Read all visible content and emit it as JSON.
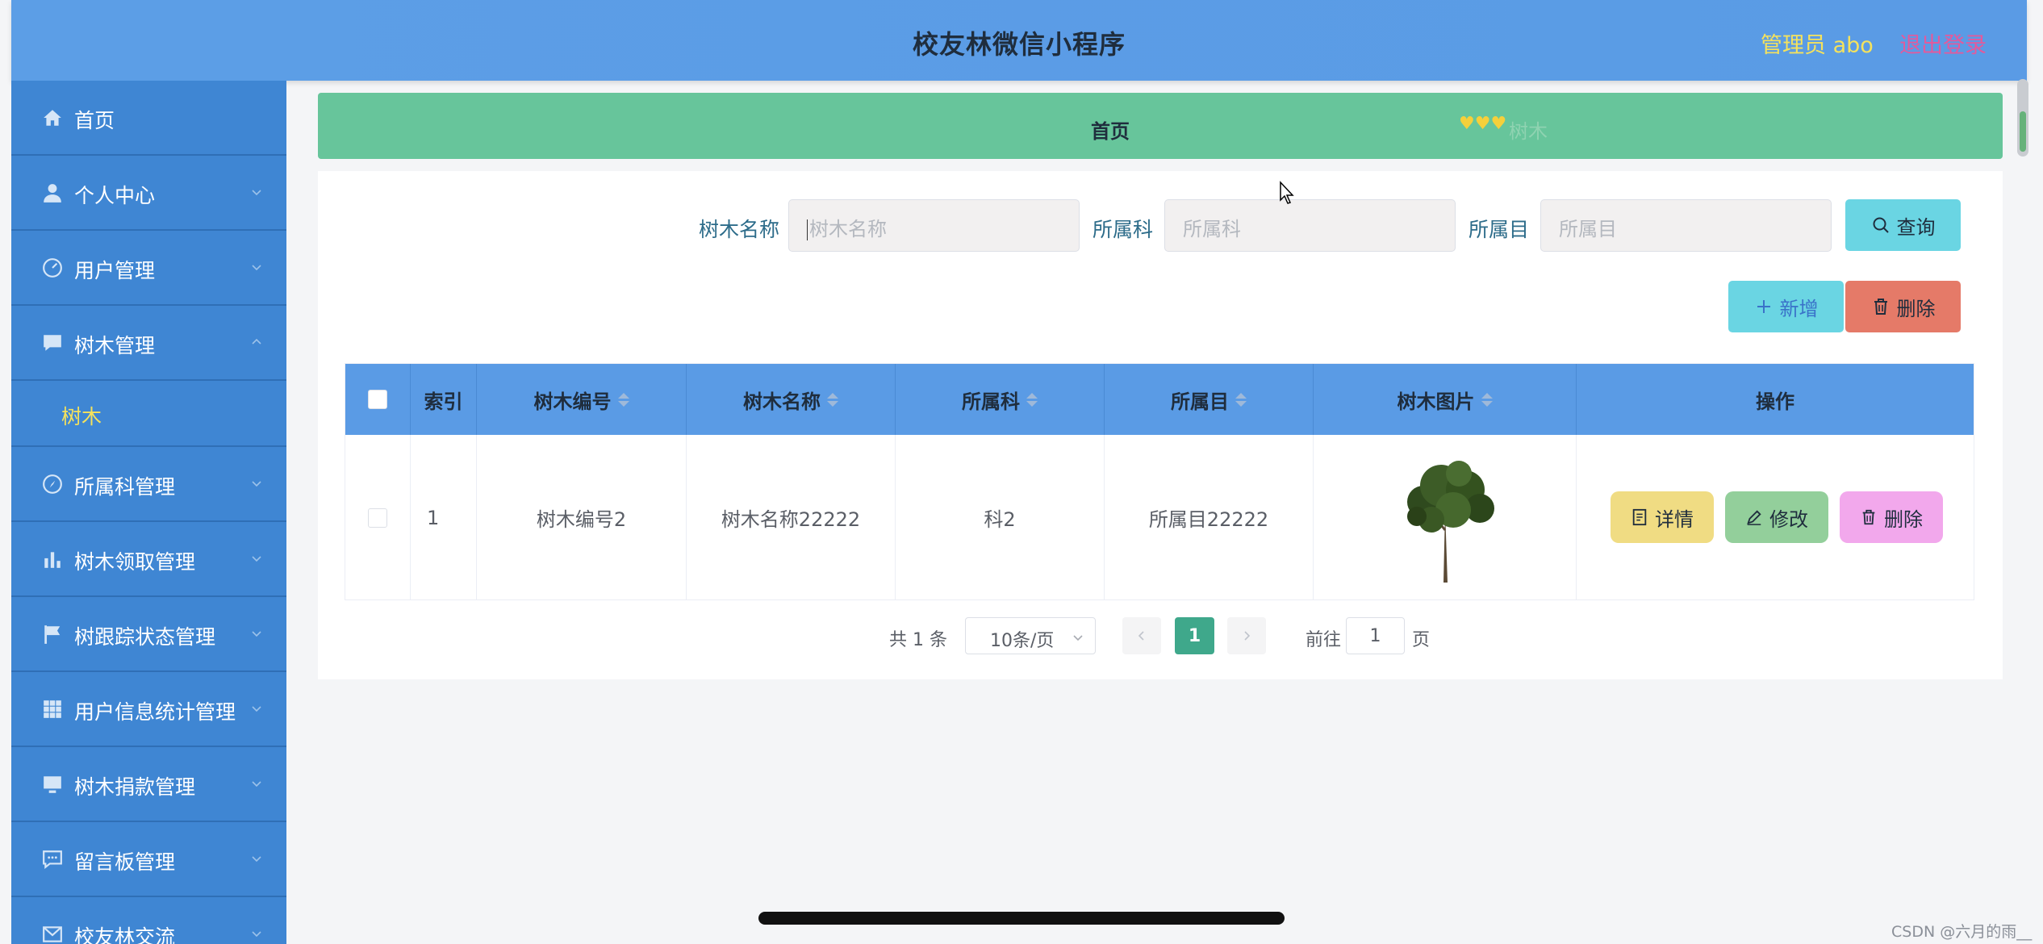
{
  "header": {
    "title": "校友林微信小程序",
    "admin": "管理员 abo",
    "logout": "退出登录"
  },
  "sidebar": {
    "items": [
      {
        "label": "首页",
        "icon": "home-icon"
      },
      {
        "label": "个人中心",
        "icon": "user-icon"
      },
      {
        "label": "用户管理",
        "icon": "dashboard-icon"
      },
      {
        "label": "树木管理",
        "icon": "chat-icon"
      },
      {
        "label": "树木",
        "icon": ""
      },
      {
        "label": "所属科管理",
        "icon": "compass-icon"
      },
      {
        "label": "树木领取管理",
        "icon": "bar-chart-icon"
      },
      {
        "label": "树跟踪状态管理",
        "icon": "flag-icon"
      },
      {
        "label": "用户信息统计管理",
        "icon": "grid-icon"
      },
      {
        "label": "树木捐款管理",
        "icon": "monitor-icon"
      },
      {
        "label": "留言板管理",
        "icon": "message-icon"
      },
      {
        "label": "校友林交流",
        "icon": "mail-icon"
      }
    ]
  },
  "breadcrumb": {
    "home": "首页",
    "hearts": "♥♥♥",
    "current": "树木"
  },
  "filters": {
    "tree_name_label": "树木名称",
    "tree_name_placeholder": "树木名称",
    "family_label": "所属科",
    "family_placeholder": "所属科",
    "order_label": "所属目",
    "order_placeholder": "所属目",
    "search_button": "查询"
  },
  "actions": {
    "add_button": "新增",
    "delete_button": "删除"
  },
  "table": {
    "columns": [
      "索引",
      "树木编号",
      "树木名称",
      "所属科",
      "所属目",
      "树木图片",
      "操作"
    ],
    "rows": [
      {
        "index": "1",
        "tree_no": "树木编号2",
        "tree_name": "树木名称22222",
        "family": "科2",
        "order": "所属目22222"
      }
    ],
    "row_actions": {
      "detail": "详情",
      "edit": "修改",
      "delete": "删除"
    }
  },
  "pagination": {
    "total": "共 1 条",
    "page_size": "10条/页",
    "current_page": "1",
    "goto_label": "前往",
    "goto_value": "1",
    "goto_unit": "页"
  },
  "watermark": "CSDN @六月的雨__",
  "colors": {
    "header_bg": "#5a9be5",
    "sidebar_bg": "#3f86d3",
    "breadcrumb_bg": "#67c59b",
    "accent_yellow": "#f5e25c",
    "logout_pink": "#e35a9c",
    "search_btn": "#6ad5e3",
    "add_btn": "#6ad5e3",
    "delete_btn": "#e57a68",
    "detail_btn": "#f0dc83",
    "edit_btn": "#93cf9b",
    "row_delete_btn": "#f2a8ec",
    "page_active": "#3fa88b"
  }
}
